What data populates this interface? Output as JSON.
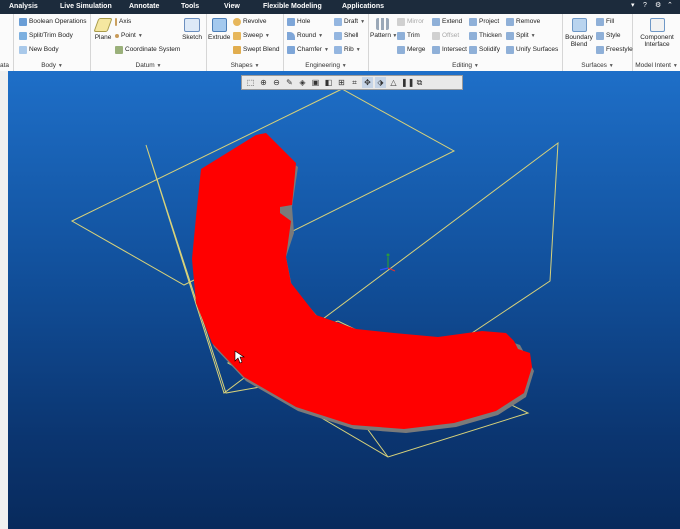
{
  "menu": {
    "items": [
      "Analysis",
      "Live Simulation",
      "Annotate",
      "Tools",
      "View",
      "Flexible Modeling",
      "Applications"
    ]
  },
  "ribbon": {
    "left_partial": "ata",
    "body": {
      "items": [
        "Boolean Operations",
        "Split/Trim Body",
        "New Body"
      ],
      "label": "Body"
    },
    "datum": {
      "plane": "Plane",
      "items": [
        "Axis",
        "Point",
        "Coordinate System"
      ],
      "sketch": "Sketch",
      "label": "Datum"
    },
    "shapes": {
      "extrude": "Extrude",
      "items": [
        "Revolve",
        "Sweep",
        "Swept Blend"
      ],
      "label": "Shapes"
    },
    "engineering": {
      "col1": [
        "Hole",
        "Round",
        "Chamfer"
      ],
      "col2": [
        "Draft",
        "Shell",
        "Rib"
      ],
      "label": "Engineering"
    },
    "editing": {
      "pattern": "Pattern",
      "col1": [
        "Mirror",
        "Trim",
        "Merge"
      ],
      "col2": [
        "Extend",
        "Offset",
        "Intersect"
      ],
      "col3": [
        "Project",
        "Thicken",
        "Solidify"
      ],
      "col4": [
        "Remove",
        "Split",
        "Unify Surfaces"
      ],
      "label": "Editing"
    },
    "surfaces": {
      "boundary": "Boundary Blend",
      "items": [
        "Fill",
        "Style",
        "Freestyle"
      ],
      "label": "Surfaces"
    },
    "model_intent": {
      "component": "Component Interface",
      "label": "Model Intent"
    }
  },
  "viewport": {
    "part_color": "#ff0000",
    "datum_color": "#d8d27a",
    "triad_colors": [
      "#2a9a3a",
      "#e03030",
      "#3050ff"
    ]
  },
  "view_toolbar": {
    "icons": [
      "refit-icon",
      "zoom-in-icon",
      "zoom-out-icon",
      "repaint-icon",
      "view-orient-icon",
      "saved-views-icon",
      "display-style-icon",
      "datum-display-icon",
      "annotation-display-icon",
      "spin-center-icon",
      "perspective-icon",
      "triangle-icon",
      "pause-icon",
      "section-icon"
    ]
  }
}
